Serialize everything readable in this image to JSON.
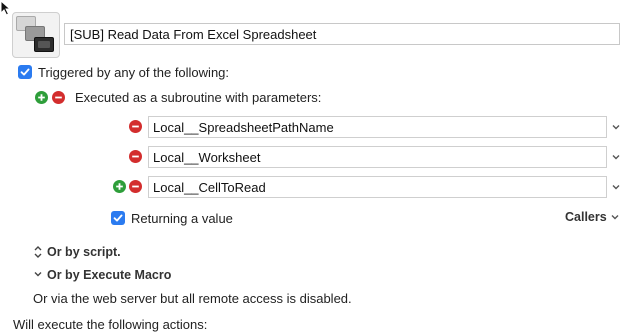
{
  "macro": {
    "name": "[SUB] Read Data From Excel Spreadsheet"
  },
  "trigger": {
    "checkbox_label": "Triggered by any of the following:",
    "checked": true,
    "subroutine_label": "Executed as a subroutine with parameters:",
    "parameters": [
      {
        "value": "Local__SpreadsheetPathName"
      },
      {
        "value": "Local__Worksheet"
      },
      {
        "value": "Local__CellToRead"
      }
    ],
    "returning_label": "Returning a value",
    "returning_checked": true,
    "callers_label": "Callers"
  },
  "options": {
    "or_by_script": "Or by script.",
    "or_by_execute_macro": "Or by Execute Macro",
    "web_server_note": "Or via the web server but all remote access is disabled."
  },
  "actions": {
    "heading": "Will execute the following actions:"
  },
  "colors": {
    "accent": "#2b7bf0",
    "add": "#2e9e3a",
    "remove": "#d32d2d"
  }
}
